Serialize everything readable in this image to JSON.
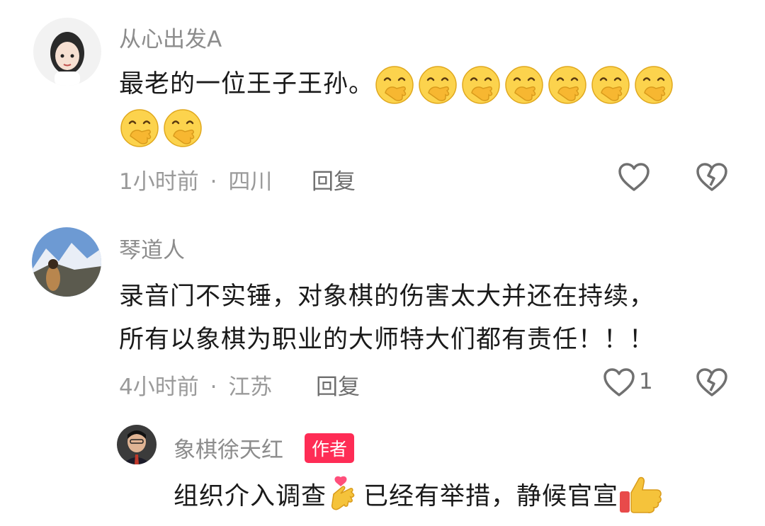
{
  "comments": [
    {
      "username": "从心出发A",
      "line1_text": "最老的一位王子王孙。",
      "emoji_name": "hand-over-mouth-emoji",
      "emoji_count_line1": 7,
      "emoji_count_line2": 2,
      "time": "1小时前",
      "location": "四川",
      "reply_label": "回复"
    },
    {
      "username": "琴道人",
      "line1": "录音门不实锤，对象棋的伤害太大并还在持续，",
      "line2": "所有以象棋为职业的大师特大们都有责任！！！",
      "time": "4小时前",
      "location": "江苏",
      "reply_label": "回复",
      "like_count": "1"
    },
    {
      "username": "象棋徐天红",
      "badge": "作者",
      "text_part1": "组织介入调查",
      "text_part2": "已经有举措，静候官宣",
      "emoji_mid": "heart-hand-emoji",
      "emoji_end": "thumbs-up-emoji"
    }
  ],
  "separator": "·",
  "colors": {
    "badge": "#fe2c55",
    "meta": "#9a9a9a",
    "text": "#1a1a1a"
  },
  "icons": {
    "like": "heart-outline-icon",
    "dislike": "broken-heart-icon"
  }
}
